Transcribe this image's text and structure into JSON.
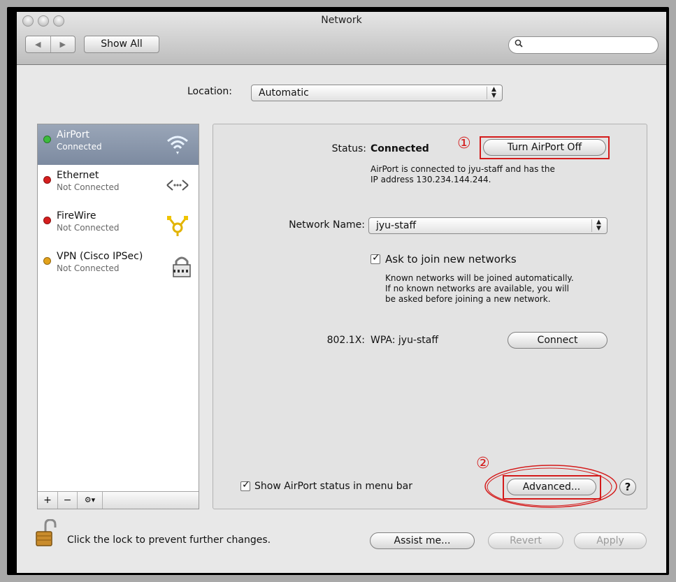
{
  "window": {
    "title": "Network"
  },
  "toolbar": {
    "show_all": "Show All",
    "search_placeholder": ""
  },
  "location": {
    "label": "Location:",
    "value": "Automatic"
  },
  "services": [
    {
      "name": "AirPort",
      "status": "Connected",
      "dot_color": "#3dbb3d",
      "icon": "wifi-icon",
      "selected": true
    },
    {
      "name": "Ethernet",
      "status": "Not Connected",
      "dot_color": "#d61e1e",
      "icon": "ethernet-icon",
      "selected": false
    },
    {
      "name": "FireWire",
      "status": "Not Connected",
      "dot_color": "#d61e1e",
      "icon": "firewire-icon",
      "selected": false
    },
    {
      "name": "VPN (Cisco IPSec)",
      "status": "Not Connected",
      "dot_color": "#e3a21a",
      "icon": "vpn-lock-icon",
      "selected": false
    }
  ],
  "sidebar_controls": {
    "add": "+",
    "remove": "−",
    "action": "⚙▾"
  },
  "detail": {
    "status_label": "Status:",
    "status_value": "Connected",
    "turn_off_button": "Turn AirPort Off",
    "status_description_1": "AirPort is connected to jyu-staff and has the",
    "status_description_2": "IP address 130.234.144.244.",
    "network_name_label": "Network Name:",
    "network_name_value": "jyu-staff",
    "ask_join_label": "Ask to join new networks",
    "ask_join_desc_1": "Known networks will be joined automatically.",
    "ask_join_desc_2": "If no known networks are available, you will",
    "ask_join_desc_3": "be asked before joining a new network.",
    "dot1x_label": "802.1X:",
    "dot1x_value": "WPA: jyu-staff",
    "connect_button": "Connect",
    "show_status_label": "Show AirPort status in menu bar",
    "advanced_button": "Advanced...",
    "help": "?"
  },
  "footer": {
    "lock_text": "Click the lock to prevent further changes.",
    "assist_button": "Assist me...",
    "revert_button": "Revert",
    "apply_button": "Apply"
  },
  "annotations": {
    "one": "①",
    "two": "②",
    "color": "#d41b1b"
  }
}
